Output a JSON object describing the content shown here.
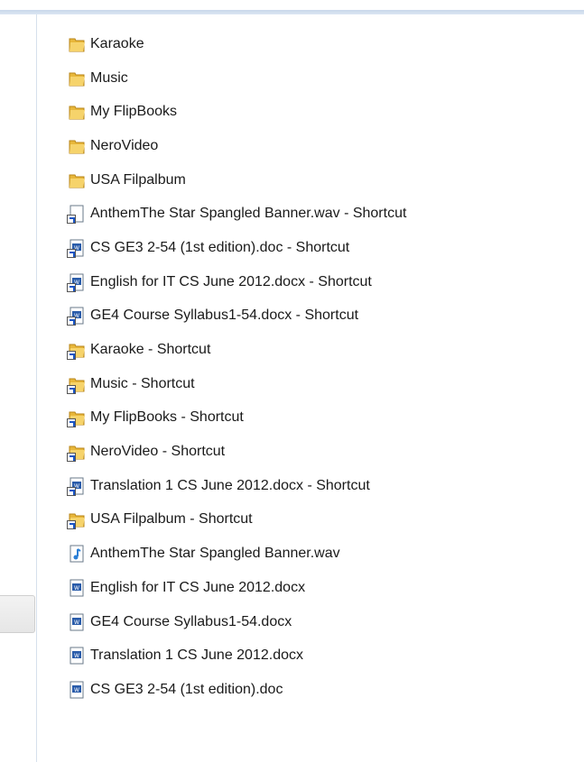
{
  "files": [
    {
      "name": "Karaoke",
      "type": "folder"
    },
    {
      "name": "Music",
      "type": "folder"
    },
    {
      "name": "My FlipBooks",
      "type": "folder"
    },
    {
      "name": "NeroVideo",
      "type": "folder"
    },
    {
      "name": "USA Filpalbum",
      "type": "folder"
    },
    {
      "name": "AnthemThe Star Spangled Banner.wav - Shortcut",
      "type": "shortcut-file"
    },
    {
      "name": "CS GE3 2-54 (1st edition).doc - Shortcut",
      "type": "shortcut-doc"
    },
    {
      "name": "English for IT CS June 2012.docx - Shortcut",
      "type": "shortcut-doc"
    },
    {
      "name": "GE4  Course Syllabus1-54.docx - Shortcut",
      "type": "shortcut-doc"
    },
    {
      "name": "Karaoke - Shortcut",
      "type": "shortcut-folder"
    },
    {
      "name": "Music - Shortcut",
      "type": "shortcut-folder"
    },
    {
      "name": "My FlipBooks - Shortcut",
      "type": "shortcut-folder"
    },
    {
      "name": "NeroVideo - Shortcut",
      "type": "shortcut-folder"
    },
    {
      "name": "Translation 1 CS June 2012.docx - Shortcut",
      "type": "shortcut-doc"
    },
    {
      "name": "USA Filpalbum - Shortcut",
      "type": "shortcut-folder"
    },
    {
      "name": "AnthemThe Star Spangled Banner.wav",
      "type": "audio"
    },
    {
      "name": "English for IT CS June 2012.docx",
      "type": "word-doc"
    },
    {
      "name": "GE4  Course Syllabus1-54.docx",
      "type": "word-doc"
    },
    {
      "name": "Translation 1 CS June 2012.docx",
      "type": "word-doc"
    },
    {
      "name": "CS GE3 2-54 (1st edition).doc",
      "type": "word-doc"
    }
  ],
  "colors": {
    "folder": "#e8b73a",
    "word": "#2a5caa",
    "audio": "#2b7fd6"
  }
}
